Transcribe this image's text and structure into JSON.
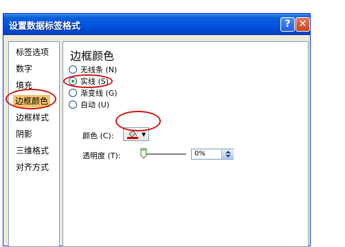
{
  "window": {
    "title": "设置数据标签格式",
    "help_label": "?",
    "close_label": "✕"
  },
  "sidebar": {
    "items": [
      {
        "label": "标签选项"
      },
      {
        "label": "数字"
      },
      {
        "label": "填充"
      },
      {
        "label": "边框颜色",
        "selected": true
      },
      {
        "label": "边框样式"
      },
      {
        "label": "阴影"
      },
      {
        "label": "三维格式"
      },
      {
        "label": "对齐方式"
      }
    ]
  },
  "content": {
    "section_title": "边框颜色",
    "options": [
      {
        "label": "无线条 (N)",
        "checked": false
      },
      {
        "label": "实线 (S)",
        "checked": true
      },
      {
        "label": "渐变线 (G)",
        "checked": false
      },
      {
        "label": "自动 (U)",
        "checked": false
      }
    ],
    "color_label": "颜色 (C):",
    "transparency_label": "透明度 (T):",
    "transparency_value": "0%"
  },
  "colors": {
    "title_bar": "#0054e3",
    "selected_bg": "#f6c36a",
    "annotation": "#cc1414",
    "line_color": "#cc0000"
  }
}
